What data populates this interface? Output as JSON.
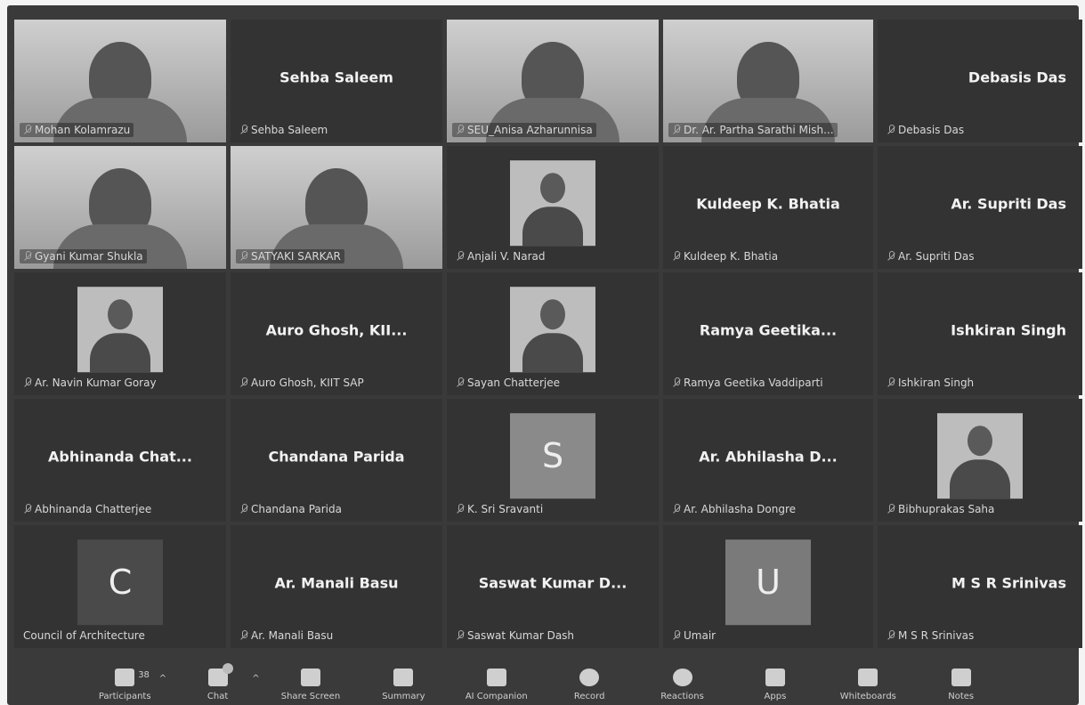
{
  "tiles": [
    {
      "type": "video",
      "label": "Mohan Kolamrazu"
    },
    {
      "type": "name",
      "display": "Sehba Saleem",
      "label": "Sehba Saleem"
    },
    {
      "type": "video",
      "label": "SEU_Anisa Azharunnisa"
    },
    {
      "type": "video",
      "label": "Dr. Ar. Partha Sarathi Mish..."
    },
    {
      "type": "name",
      "display": "Debasis Das",
      "label": "Debasis Das"
    },
    {
      "type": "video",
      "label": "Gyani Kumar Shukla"
    },
    {
      "type": "video",
      "label": "SATYAKI SARKAR",
      "active": true
    },
    {
      "type": "photo",
      "label": "Anjali V. Narad"
    },
    {
      "type": "name",
      "display": "Kuldeep K. Bhatia",
      "label": "Kuldeep K. Bhatia"
    },
    {
      "type": "name",
      "display": "Ar. Supriti Das",
      "label": "Ar. Supriti Das"
    },
    {
      "type": "photo",
      "label": "Ar. Navin Kumar Goray"
    },
    {
      "type": "name",
      "display": "Auro Ghosh, KII...",
      "label": "Auro Ghosh, KIIT SAP"
    },
    {
      "type": "photo",
      "label": "Sayan Chatterjee"
    },
    {
      "type": "name",
      "display": "Ramya Geetika...",
      "label": "Ramya Geetika Vaddiparti"
    },
    {
      "type": "name",
      "display": "Ishkiran Singh",
      "label": "Ishkiran Singh"
    },
    {
      "type": "name",
      "display": "Abhinanda Chat...",
      "label": "Abhinanda Chatterjee"
    },
    {
      "type": "name",
      "display": "Chandana Parida",
      "label": "Chandana Parida"
    },
    {
      "type": "avatar",
      "letter": "S",
      "label": "K. Sri Sravanti",
      "color": "#8a8a8a"
    },
    {
      "type": "name",
      "display": "Ar. Abhilasha D...",
      "label": "Ar. Abhilasha Dongre"
    },
    {
      "type": "photo",
      "label": "Bibhuprakas Saha"
    },
    {
      "type": "avatar",
      "letter": "C",
      "label": "Council of Architecture",
      "color": "#4a4a4a"
    },
    {
      "type": "name",
      "display": "Ar. Manali Basu",
      "label": "Ar. Manali Basu"
    },
    {
      "type": "name",
      "display": "Saswat Kumar D...",
      "label": "Saswat Kumar Dash"
    },
    {
      "type": "avatar",
      "letter": "U",
      "label": "Umair",
      "color": "#7a7a7a"
    },
    {
      "type": "name",
      "display": "M S R Srinivas",
      "label": "M S R Srinivas"
    }
  ],
  "toolbar": {
    "participants_label": "Participants",
    "participants_count": "38",
    "chat_label": "Chat",
    "share_label": "Share Screen",
    "summary_label": "Summary",
    "ai_label": "AI Companion",
    "record_label": "Record",
    "reactions_label": "Reactions",
    "apps_label": "Apps",
    "whiteboards_label": "Whiteboards",
    "notes_label": "Notes"
  }
}
